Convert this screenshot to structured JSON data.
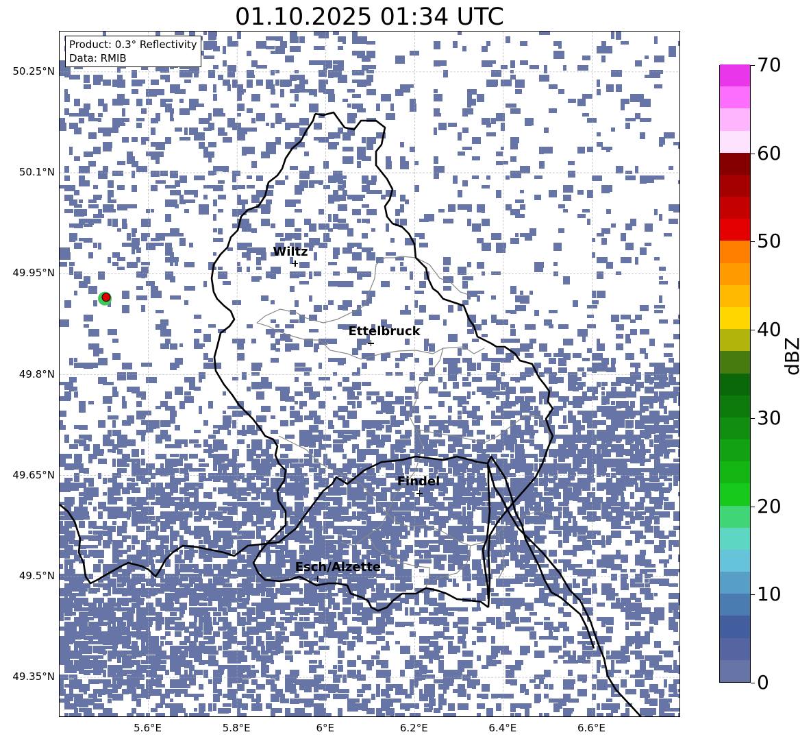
{
  "title": "01.10.2025 01:34 UTC",
  "info": {
    "product": "Product: 0.3° Reflectivity",
    "data": "Data: RMIB"
  },
  "lat_ticks": [
    "50.25°N",
    "50.1°N",
    "49.95°N",
    "49.8°N",
    "49.65°N",
    "49.5°N",
    "49.35°N"
  ],
  "lon_ticks": [
    "5.6°E",
    "5.8°E",
    "6°E",
    "6.2°E",
    "6.4°E",
    "6.6°E"
  ],
  "cities": [
    {
      "name": "Wiltz",
      "lon": 5.93,
      "lat": 49.966
    },
    {
      "name": "Ettelbruck",
      "lon": 6.1,
      "lat": 49.847
    },
    {
      "name": "Findel",
      "lon": 6.21,
      "lat": 49.624
    },
    {
      "name": "Esch/Alzette",
      "lon": 5.98,
      "lat": 49.497
    }
  ],
  "radar_site": {
    "lon": 5.505,
    "lat": 49.915
  },
  "colorbar": {
    "label": "dBZ",
    "ticks": [
      "0",
      "10",
      "20",
      "30",
      "40",
      "50",
      "60",
      "70"
    ],
    "min": 0,
    "max": 70,
    "step": 2.5,
    "colors": [
      "#6675a6",
      "#5565a1",
      "#435e9f",
      "#4a7bb1",
      "#579fc7",
      "#66c4da",
      "#5dd6c3",
      "#40d575",
      "#16c91b",
      "#13b513",
      "#11a111",
      "#0f8e0f",
      "#0c7b0c",
      "#0a670a",
      "#477b10",
      "#b0b40b",
      "#fed700",
      "#feb900",
      "#fe9b00",
      "#fe7e00",
      "#e40000",
      "#c50000",
      "#a50000",
      "#850000",
      "#fee3fe",
      "#feb5fe",
      "#fe6efe",
      "#ea36ea"
    ]
  },
  "echo_color": "#6675a6",
  "map_extent": {
    "lon_min": 5.4,
    "lon_max": 6.8,
    "lat_min": 49.29,
    "lat_max": 50.31
  }
}
